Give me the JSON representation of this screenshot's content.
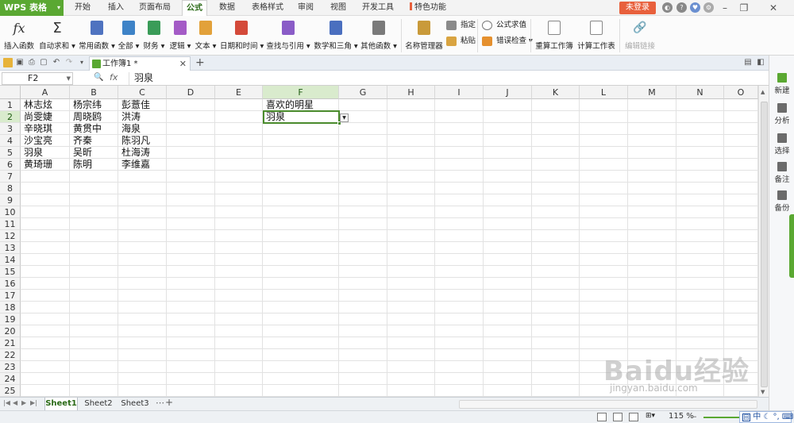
{
  "app": {
    "logo": "WPS 表格",
    "login": "未登录"
  },
  "menu": [
    "开始",
    "插入",
    "页面布局",
    "公式",
    "数据",
    "表格样式",
    "审阅",
    "视图",
    "开发工具",
    "特色功能"
  ],
  "menu_active": "公式",
  "ribbon": {
    "insert_func": "插入函数",
    "autosum": "自动求和",
    "common": "常用函数",
    "all": "全部",
    "finance": "财务",
    "logic": "逻辑",
    "text": "文本",
    "datetime": "日期和时间",
    "lookup": "查找与引用",
    "math": "数学和三角",
    "other": "其他函数",
    "name_mgr": "名称管理器",
    "specify": "指定",
    "paste": "粘贴",
    "formula_eval": "公式求值",
    "error_check": "错误检查",
    "recalc_book": "重算工作簿",
    "calc_sheet": "计算工作表",
    "edit_links": "编辑链接"
  },
  "doc_tab": "工作簿1 *",
  "formula_bar": {
    "name_box": "F2",
    "fx": "fx",
    "value": "羽泉"
  },
  "columns": [
    "A",
    "B",
    "C",
    "D",
    "E",
    "F",
    "G",
    "H",
    "I",
    "J",
    "K",
    "L",
    "M",
    "N",
    "O"
  ],
  "rows": [
    "1",
    "2",
    "3",
    "4",
    "5",
    "6",
    "7",
    "8",
    "9",
    "10",
    "11",
    "12",
    "13",
    "14",
    "15",
    "16",
    "17",
    "18",
    "19",
    "20",
    "21",
    "22",
    "23",
    "24",
    "25"
  ],
  "cells": {
    "A": [
      "林志炫",
      "尚雯婕",
      "辛晓琪",
      "沙宝亮",
      "羽泉",
      "黄琦珊"
    ],
    "B": [
      "杨宗纬",
      "周晓鸥",
      "黄贯中",
      "齐秦",
      "吴昕",
      "陈明"
    ],
    "C": [
      "彭薏佳",
      "洪涛",
      "海泉",
      "陈羽凡",
      "杜海涛",
      "李维嘉"
    ],
    "F1": "喜欢的明星",
    "F2": "羽泉"
  },
  "sheets": [
    "Sheet1",
    "Sheet2",
    "Sheet3"
  ],
  "status": {
    "zoom": "115 %"
  },
  "ime": "中",
  "right_pane": [
    "新建",
    "分析",
    "选择",
    "备注",
    "备份"
  ],
  "watermark": {
    "text": "Baidu经验",
    "url": "jingyan.baidu.com"
  },
  "colors": {
    "accent": "#5aa832",
    "selected_header": "#d9ebcd",
    "login": "#e8603c"
  }
}
